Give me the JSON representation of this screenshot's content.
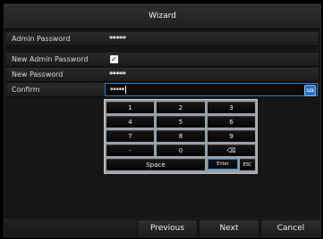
{
  "window": {
    "title": "Wizard"
  },
  "form": {
    "admin_password": {
      "label": "Admin Password",
      "value": "*****"
    },
    "new_admin_password": {
      "label": "New Admin Password",
      "checked": true
    },
    "new_password": {
      "label": "New Password",
      "value": "*****"
    },
    "confirm": {
      "label": "Confirm",
      "value": "*****",
      "ime_label": "123"
    }
  },
  "keyboard": {
    "rows": [
      [
        "1",
        "2",
        "3"
      ],
      [
        "4",
        "5",
        "6"
      ],
      [
        "7",
        "8",
        "9"
      ],
      [
        "-",
        "0",
        "⌫"
      ]
    ],
    "space_label": "Space",
    "enter_label": "Enter",
    "esc_label": "ESC"
  },
  "buttons": {
    "previous": "Previous",
    "next": "Next",
    "cancel": "Cancel"
  },
  "colors": {
    "accent": "#2f7fc0",
    "background": "#161616"
  }
}
